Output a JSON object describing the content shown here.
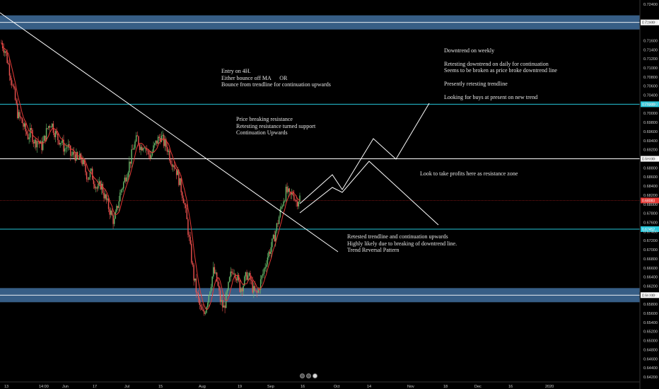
{
  "chart_data": {
    "type": "candlestick",
    "title": "",
    "price_axis": {
      "ylim": [
        0.642,
        0.724
      ],
      "ticks": [
        "0.72400",
        "0.72000",
        "0.71600",
        "0.71400",
        "0.71200",
        "0.71000",
        "0.70800",
        "0.70600",
        "0.70400",
        "0.70200",
        "0.70000",
        "0.69800",
        "0.69600",
        "0.69400",
        "0.69200",
        "0.69000",
        "0.68800",
        "0.68600",
        "0.68400",
        "0.68200",
        "0.68000",
        "0.67800",
        "0.67600",
        "0.67400",
        "0.67200",
        "0.67000",
        "0.66800",
        "0.66600",
        "0.66400",
        "0.66200",
        "0.66000",
        "0.65800",
        "0.65600",
        "0.65400",
        "0.65200",
        "0.65000",
        "0.64800",
        "0.64600",
        "0.64400",
        "0.64200"
      ]
    },
    "time_axis": {
      "labels": [
        "13",
        "14:00",
        "Jun",
        "17",
        "Jul",
        "15",
        "Aug",
        "19",
        "Sep",
        "16",
        "Oct",
        "14",
        "Nov",
        "18",
        "Dec",
        "16",
        "2020"
      ]
    },
    "horizontal_levels": [
      {
        "price": 0.72,
        "label": "0.72000",
        "style": "zone"
      },
      {
        "price": 0.702,
        "label": "0.70200",
        "style": "line"
      },
      {
        "price": 0.69,
        "label": "0.69000",
        "style": "line"
      },
      {
        "price": 0.68083,
        "label": "0.68083",
        "style": "current"
      },
      {
        "price": 0.67452,
        "label": "0.67452",
        "style": "line"
      },
      {
        "price": 0.66,
        "label": "0.66000",
        "style": "zone"
      }
    ],
    "ohlc_path": [
      0.7155,
      0.714,
      0.711,
      0.7075,
      0.7035,
      0.6995,
      0.6985,
      0.6965,
      0.695,
      0.6958,
      0.6935,
      0.6942,
      0.6925,
      0.6945,
      0.697,
      0.698,
      0.696,
      0.6945,
      0.6938,
      0.6922,
      0.6928,
      0.6905,
      0.6912,
      0.6895,
      0.6902,
      0.688,
      0.686,
      0.687,
      0.685,
      0.6832,
      0.6845,
      0.682,
      0.68,
      0.678,
      0.676,
      0.6795,
      0.683,
      0.685,
      0.6875,
      0.69,
      0.693,
      0.6945,
      0.6925,
      0.6935,
      0.6915,
      0.6905,
      0.6925,
      0.694,
      0.695,
      0.6935,
      0.6925,
      0.69,
      0.689,
      0.687,
      0.684,
      0.681,
      0.676,
      0.67,
      0.664,
      0.66,
      0.657,
      0.6555,
      0.6585,
      0.662,
      0.6655,
      0.663,
      0.659,
      0.657,
      0.66,
      0.664,
      0.666,
      0.664,
      0.6615,
      0.6625,
      0.6645,
      0.6635,
      0.661,
      0.66,
      0.6625,
      0.665,
      0.668,
      0.67,
      0.672,
      0.675,
      0.678,
      0.681,
      0.683,
      0.6815,
      0.6825,
      0.6805,
      0.6815
    ],
    "moving_average_color": "#e53935",
    "projection_color": "#ffffff",
    "level_color": "#26c6da",
    "zone_color": "#4a7db3",
    "up_color": "#66bb6a",
    "down_color": "#ef5350"
  },
  "annotations": {
    "entry": "Entry on 4H.\nEither bounce off MA      OR\nBounce from trendline for continuation upwards",
    "breaking": "Price breaking resistance\nRetesting resistance turned support\nContinuation Upwards",
    "downtrend": "Downtrend on weekly\n\nRetesting downtrend on daily for continuation\nSeems to be broken as price broke downtrend line\n\nPresently retesting trendline\n\nLooking for buys at present on new trend",
    "profits": "Look to take profits here as resistance zone",
    "retested": "Retested trendline and continuation upwards\nHighly likely due to breaking of downtrend line.\nTrend Reversal Pattern"
  }
}
